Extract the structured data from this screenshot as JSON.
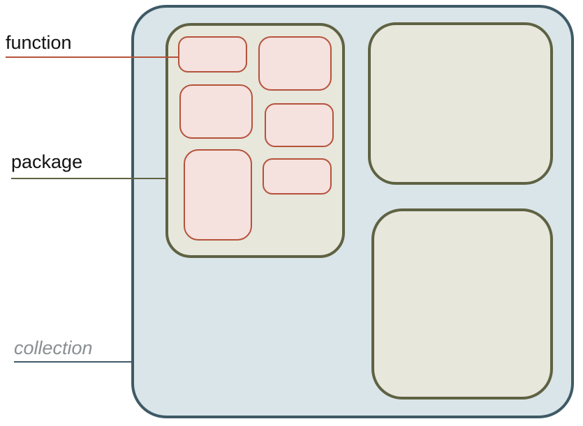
{
  "labels": {
    "function": "function",
    "package": "package",
    "collection": "collection"
  },
  "colors": {
    "collection_fill": "#d9e5e8",
    "collection_stroke": "#3f5a66",
    "package_fill": "#e7e7dc",
    "package_stroke": "#5f6242",
    "function_fill": "#f5e1de",
    "function_stroke": "#b5523b",
    "function_line": "#b5523b",
    "package_line": "#5f6242",
    "collection_line": "#3f5a66",
    "collection_text": "#8a8f92"
  }
}
